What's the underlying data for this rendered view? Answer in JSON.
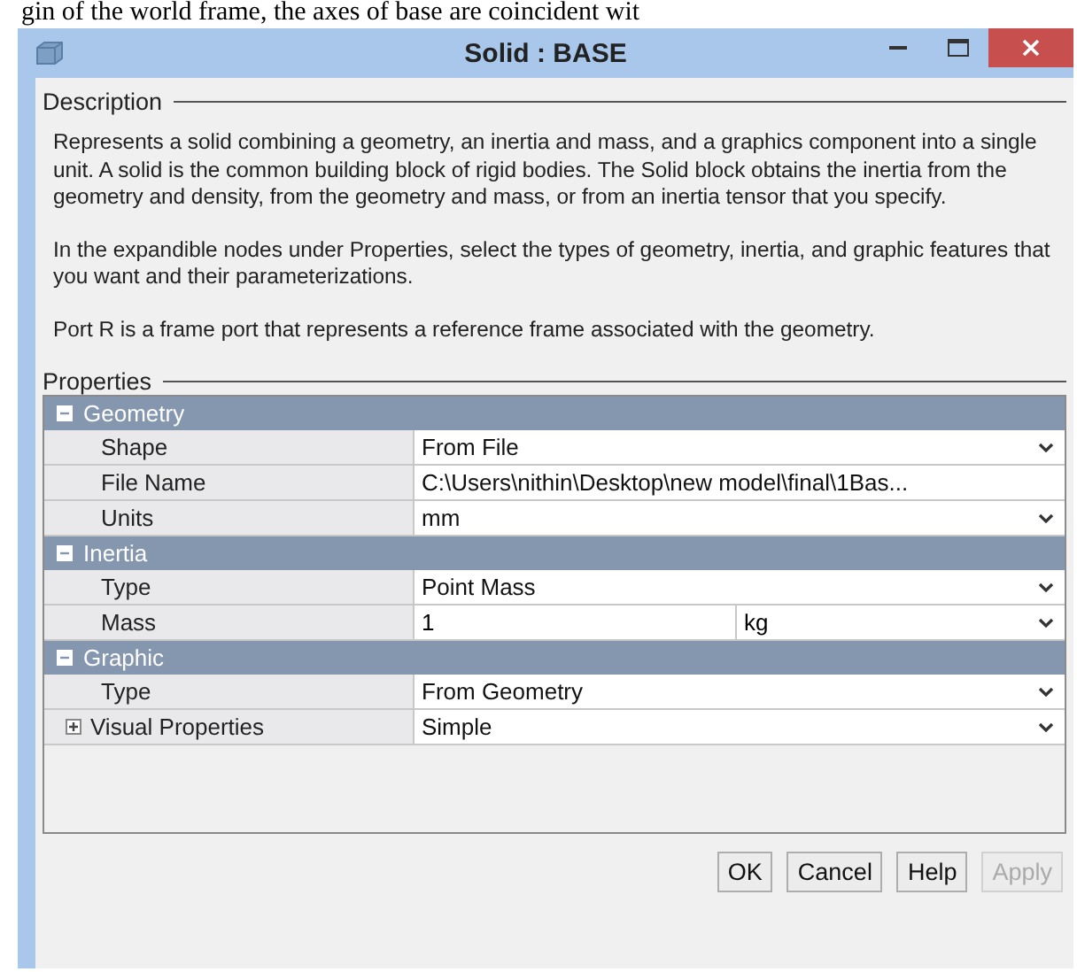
{
  "caption_above": "gin of the world frame, the axes of base are coincident wit",
  "window": {
    "title": "Solid : BASE"
  },
  "description": {
    "heading": "Description",
    "paragraphs": [
      "Represents a solid combining a geometry, an inertia and mass, and a graphics component into a single unit. A solid is the common building block of rigid bodies. The Solid block obtains the inertia from the geometry and density, from the geometry and mass, or from an inertia tensor that you specify.",
      "In the expandible nodes under Properties, select the types of geometry, inertia, and graphic features that you want and their parameterizations.",
      "Port R is a frame port that represents a reference frame associated with the geometry."
    ]
  },
  "properties": {
    "heading": "Properties",
    "groups": [
      {
        "label": "Geometry",
        "expanded": true,
        "rows": [
          {
            "kind": "dropdown",
            "name": "Shape",
            "value": "From File"
          },
          {
            "kind": "text",
            "name": "File Name",
            "value": "C:\\Users\\nithin\\Desktop\\new model\\final\\1Bas..."
          },
          {
            "kind": "dropdown",
            "name": "Units",
            "value": "mm"
          }
        ]
      },
      {
        "label": "Inertia",
        "expanded": true,
        "rows": [
          {
            "kind": "dropdown",
            "name": "Type",
            "value": "Point Mass"
          },
          {
            "kind": "value_unit",
            "name": "Mass",
            "value": "1",
            "unit": "kg"
          }
        ]
      },
      {
        "label": "Graphic",
        "expanded": true,
        "rows": [
          {
            "kind": "dropdown",
            "name": "Type",
            "value": "From Geometry"
          },
          {
            "kind": "dropdown",
            "name": "Visual Properties",
            "value": "Simple",
            "expanded": false
          }
        ]
      }
    ]
  },
  "buttons": [
    {
      "label": "OK",
      "disabled": false
    },
    {
      "label": "Cancel",
      "disabled": false
    },
    {
      "label": "Help",
      "disabled": false
    },
    {
      "label": "Apply",
      "disabled": true
    }
  ]
}
